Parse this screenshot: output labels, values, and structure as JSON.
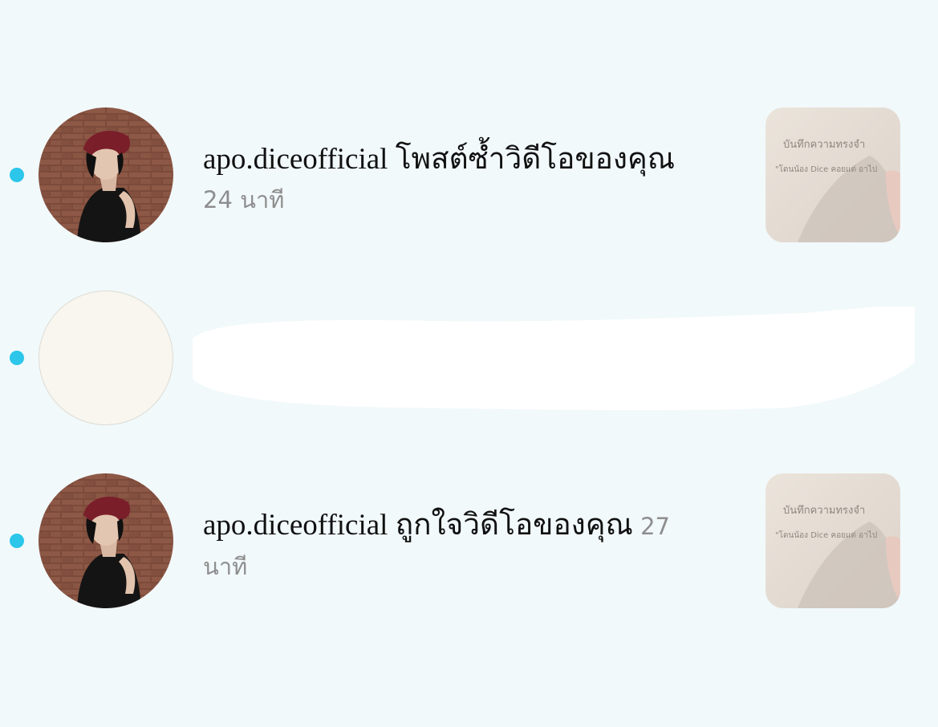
{
  "colors": {
    "background": "#f2f9fb",
    "unread_dot": "#2bc6ea",
    "timestamp": "#8e8e8e",
    "text": "#111111"
  },
  "notifications": [
    {
      "username": "apo.diceofficial",
      "action": "โพสต์ซ้ำวิดีโอของคุณ",
      "time": "24 นาที",
      "unread": true,
      "thumbnail": {
        "line1": "บันทึกความทรงจำ",
        "line2": "\"โดนน้อง Dice คอยแต่ อาไป"
      }
    },
    {
      "redacted": true,
      "unread": true
    },
    {
      "username": "apo.diceofficial",
      "action": "ถูกใจวิดีโอของคุณ",
      "time_a": "27",
      "time_b": "นาที",
      "unread": true,
      "thumbnail": {
        "line1": "บันทึกความทรงจำ",
        "line2": "\"โดนน้อง Dice คอยแต่ อาไป"
      }
    }
  ]
}
